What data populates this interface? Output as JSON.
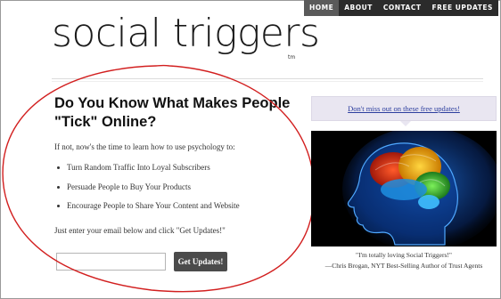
{
  "nav": {
    "items": [
      {
        "label": "HOME",
        "active": true
      },
      {
        "label": "ABOUT",
        "active": false
      },
      {
        "label": "CONTACT",
        "active": false
      },
      {
        "label": "FREE UPDATES",
        "active": false
      }
    ]
  },
  "header": {
    "logo_text": "social triggers",
    "tm": "tm"
  },
  "main": {
    "headline": "Do You Know What Makes People \"Tick\" Online?",
    "intro": "If not, now's the time to learn how to use psychology to:",
    "bullets": [
      "Turn Random Traffic Into Loyal Subscribers",
      "Persuade People to Buy Your Products",
      "Encourage People to Share Your Content and Website"
    ],
    "cta_text": "Just enter your email below and click \"Get Updates!\"",
    "email_value": "",
    "submit_label": "Get Updates!"
  },
  "sidebar": {
    "promo_link": "Don't miss out on these free updates!",
    "quote": "\"I'm totally loving Social Triggers!\"",
    "attribution": "—Chris Brogan, NYT Best-Selling Author of Trust Agents"
  },
  "colors": {
    "nav_bg": "#2b2b2b",
    "annotation": "#d21f1f",
    "link": "#2c3e9e",
    "button_bg": "#4b4b4b",
    "promo_bg": "#e9e6f1"
  }
}
